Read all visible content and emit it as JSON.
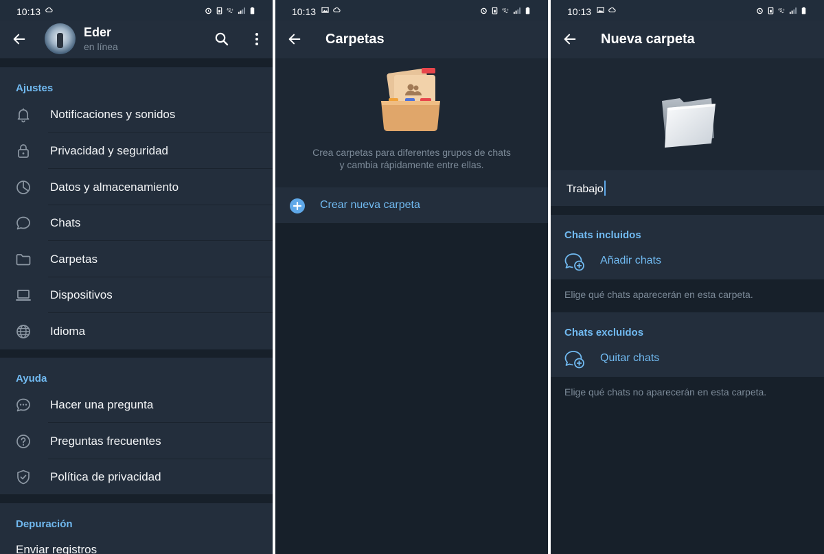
{
  "status_bar": {
    "time": "10:13"
  },
  "panel1": {
    "header": {
      "name": "Eder",
      "status": "en línea"
    },
    "settings": {
      "header": "Ajustes",
      "items": [
        {
          "label": "Notificaciones y sonidos",
          "icon": "bell-icon"
        },
        {
          "label": "Privacidad y seguridad",
          "icon": "lock-icon"
        },
        {
          "label": "Datos y almacenamiento",
          "icon": "pie-chart-icon"
        },
        {
          "label": "Chats",
          "icon": "chat-bubble-icon"
        },
        {
          "label": "Carpetas",
          "icon": "folder-icon"
        },
        {
          "label": "Dispositivos",
          "icon": "laptop-icon"
        },
        {
          "label": "Idioma",
          "icon": "globe-icon"
        }
      ]
    },
    "help": {
      "header": "Ayuda",
      "items": [
        {
          "label": "Hacer una pregunta",
          "icon": "chat-dots-icon"
        },
        {
          "label": "Preguntas frecuentes",
          "icon": "question-circle-icon"
        },
        {
          "label": "Política de privacidad",
          "icon": "shield-check-icon"
        }
      ]
    },
    "debug": {
      "header": "Depuración",
      "items": [
        {
          "label": "Enviar registros"
        }
      ]
    }
  },
  "panel2": {
    "title": "Carpetas",
    "description": "Crea carpetas para diferentes grupos de chats y cambia rápidamente entre ellas.",
    "create_label": "Crear nueva carpeta"
  },
  "panel3": {
    "title": "Nueva carpeta",
    "name_value": "Trabajo",
    "included": {
      "header": "Chats incluidos",
      "action": "Añadir chats",
      "hint": "Elige qué chats aparecerán en esta carpeta."
    },
    "excluded": {
      "header": "Chats excluidos",
      "action": "Quitar chats",
      "hint": "Elige qué chats no aparecerán en esta carpeta."
    }
  },
  "colors": {
    "background": "#1d2733",
    "surface": "#232e3c",
    "separator": "#17202a",
    "accent": "#71baf1",
    "secondary_text": "#7d8b99"
  }
}
